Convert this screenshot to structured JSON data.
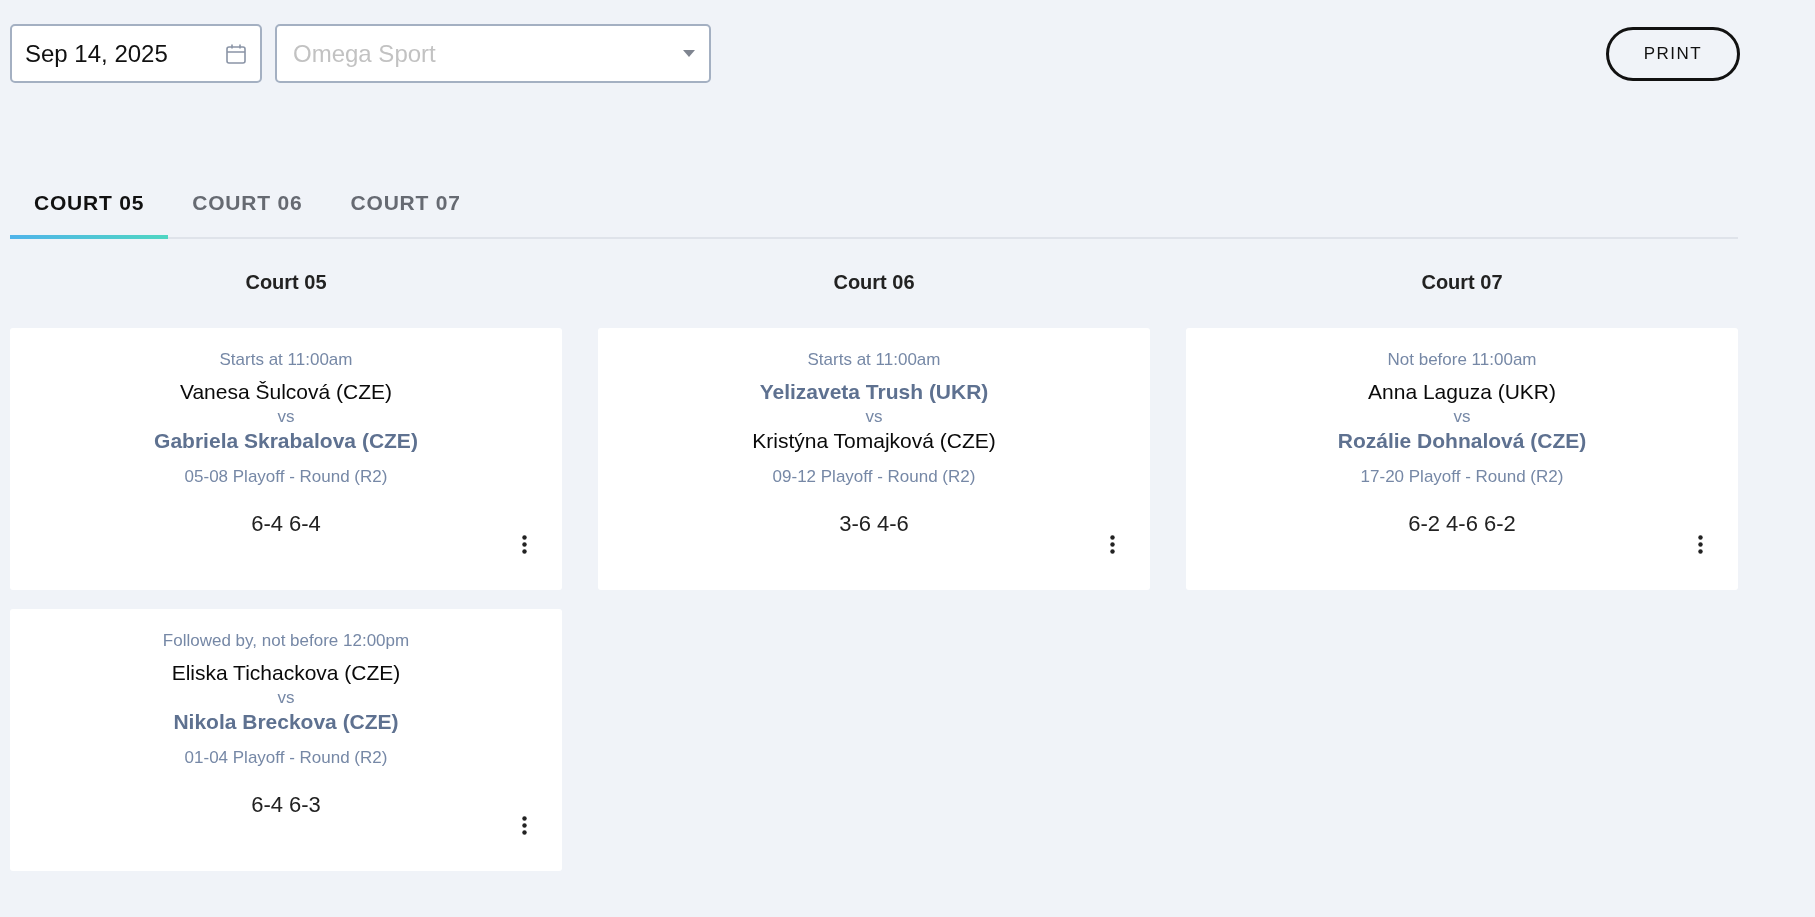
{
  "toolbar": {
    "date_field": {
      "value": "Sep 14, 2025"
    },
    "venue_select": {
      "placeholder": "Omega Sport"
    },
    "print_button": {
      "label": "PRINT"
    }
  },
  "tabs": [
    {
      "label": "COURT 05",
      "selected": true
    },
    {
      "label": "COURT 06",
      "selected": false
    },
    {
      "label": "COURT 07",
      "selected": false
    }
  ],
  "courts": [
    {
      "heading": "Court 05",
      "matches": [
        {
          "time": "Starts at 11:00am",
          "players": [
            {
              "name": "Vanesa Šulcová (CZE)",
              "winner": true
            },
            {
              "name": "Gabriela Skrabalova (CZE)",
              "winner": false
            }
          ],
          "vs": "vs",
          "round": "05-08 Playoff - Round (R2)",
          "score": "6-4 6-4"
        },
        {
          "time": "Followed by, not before 12:00pm",
          "players": [
            {
              "name": "Eliska Tichackova (CZE)",
              "winner": true
            },
            {
              "name": "Nikola Breckova (CZE)",
              "winner": false
            }
          ],
          "vs": "vs",
          "round": "01-04 Playoff - Round (R2)",
          "score": "6-4 6-3"
        }
      ]
    },
    {
      "heading": "Court 06",
      "matches": [
        {
          "time": "Starts at 11:00am",
          "players": [
            {
              "name": "Yelizaveta Trush (UKR)",
              "winner": false
            },
            {
              "name": "Kristýna Tomajková (CZE)",
              "winner": true
            }
          ],
          "vs": "vs",
          "round": "09-12 Playoff - Round (R2)",
          "score": "3-6 4-6"
        }
      ]
    },
    {
      "heading": "Court 07",
      "matches": [
        {
          "time": "Not before 11:00am",
          "players": [
            {
              "name": "Anna Laguza (UKR)",
              "winner": true
            },
            {
              "name": "Rozálie Dohnalová (CZE)",
              "winner": false
            }
          ],
          "vs": "vs",
          "round": "17-20 Playoff - Round (R2)",
          "score": "6-2 4-6 6-2"
        }
      ]
    }
  ]
}
